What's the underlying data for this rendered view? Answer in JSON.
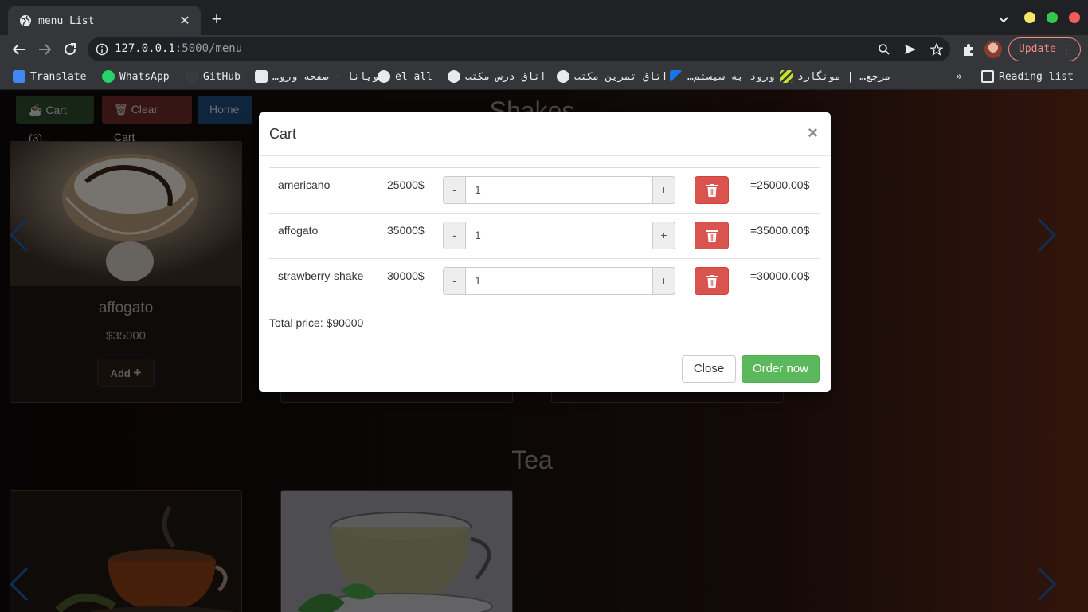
{
  "browser": {
    "tab_title": "menu List",
    "url_host": "127.0.0.1",
    "url_rest": ":5000/menu",
    "update_label": "Update",
    "bookmarks": [
      "Translate",
      "WhatsApp",
      "GitHub",
      "ویانا - صفحه ورو…",
      "el all",
      "اتاق درس مکتب",
      "اتاق تمرین مکتب",
      "ورود به سیستم…",
      "مرجع… | مونگارد"
    ],
    "reading_list": "Reading list",
    "more_bookmarks": "»"
  },
  "page": {
    "cart_button": "Cart (3)",
    "clear_cart_button": "Clear Cart",
    "home_button": "Home",
    "section_shakes": "Shakes",
    "section_tea": "Tea",
    "card_name": "affogato",
    "card_price": "$35000",
    "add_label": "Add"
  },
  "modal": {
    "title": "Cart",
    "close_x": "×",
    "items": [
      {
        "name": "americano",
        "price": "25000$",
        "minus": "-",
        "qty": "1",
        "plus": "+",
        "total": "=25000.00$"
      },
      {
        "name": "affogato",
        "price": "35000$",
        "minus": "-",
        "qty": "1",
        "plus": "+",
        "total": "=35000.00$"
      },
      {
        "name": "strawberry-shake",
        "price": "30000$",
        "minus": "-",
        "qty": "1",
        "plus": "+",
        "total": "=30000.00$"
      }
    ],
    "total_text": "Total price: $90000",
    "close_button": "Close",
    "order_button": "Order now"
  },
  "colors": {
    "success": "#5cb85c",
    "danger": "#d9534f",
    "primary": "#337ab7"
  }
}
